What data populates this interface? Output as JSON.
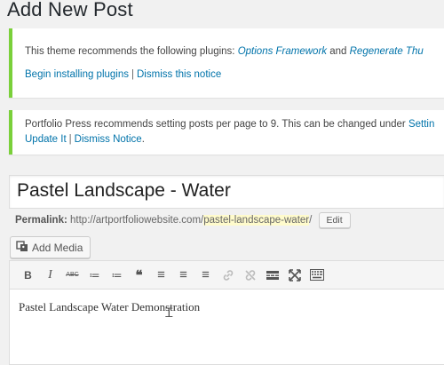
{
  "page": {
    "title": "Add New Post"
  },
  "notices": [
    {
      "line1_prefix": "This theme recommends the following plugins: ",
      "plugin1": "Options Framework",
      "and": " and ",
      "plugin2": "Regenerate Thu",
      "link1": "Begin installing plugins",
      "separator": "|",
      "link2": "Dismiss this notice"
    },
    {
      "line1_text": "Portfolio Press recommends setting posts per page to 9. This can be changed under ",
      "line1_link": "Settin",
      "link1": "Update It",
      "separator": "|",
      "link2": "Dismiss Notice",
      "end": "."
    }
  ],
  "post": {
    "title": "Pastel Landscape - Water",
    "permalink_label": "Permalink:",
    "permalink_base": " http://artportfoliowebsite.com/",
    "permalink_slug": "pastel-landscape-water",
    "permalink_trail": "/",
    "edit_label": "Edit"
  },
  "media": {
    "add_label": "Add Media"
  },
  "editor": {
    "content": "Pastel Landscape Water Demonstration",
    "toolbar": [
      {
        "name": "bold-icon",
        "glyph": "B"
      },
      {
        "name": "italic-icon",
        "glyph": "I"
      },
      {
        "name": "strikethrough-icon",
        "glyph": "ABC"
      },
      {
        "name": "bullet-list-icon",
        "glyph": "≔"
      },
      {
        "name": "numbered-list-icon",
        "glyph": "≔"
      },
      {
        "name": "blockquote-icon",
        "glyph": "❝"
      },
      {
        "name": "align-left-icon",
        "glyph": "≡"
      },
      {
        "name": "align-center-icon",
        "glyph": "≡"
      },
      {
        "name": "align-right-icon",
        "glyph": "≡"
      },
      {
        "name": "insert-link-icon",
        "glyph": "🔗"
      },
      {
        "name": "unlink-icon",
        "glyph": "⛓"
      },
      {
        "name": "insert-more-icon",
        "glyph": "▬"
      },
      {
        "name": "fullscreen-icon",
        "glyph": "⤧"
      },
      {
        "name": "toolbar-toggle-icon",
        "glyph": "▦"
      }
    ]
  }
}
